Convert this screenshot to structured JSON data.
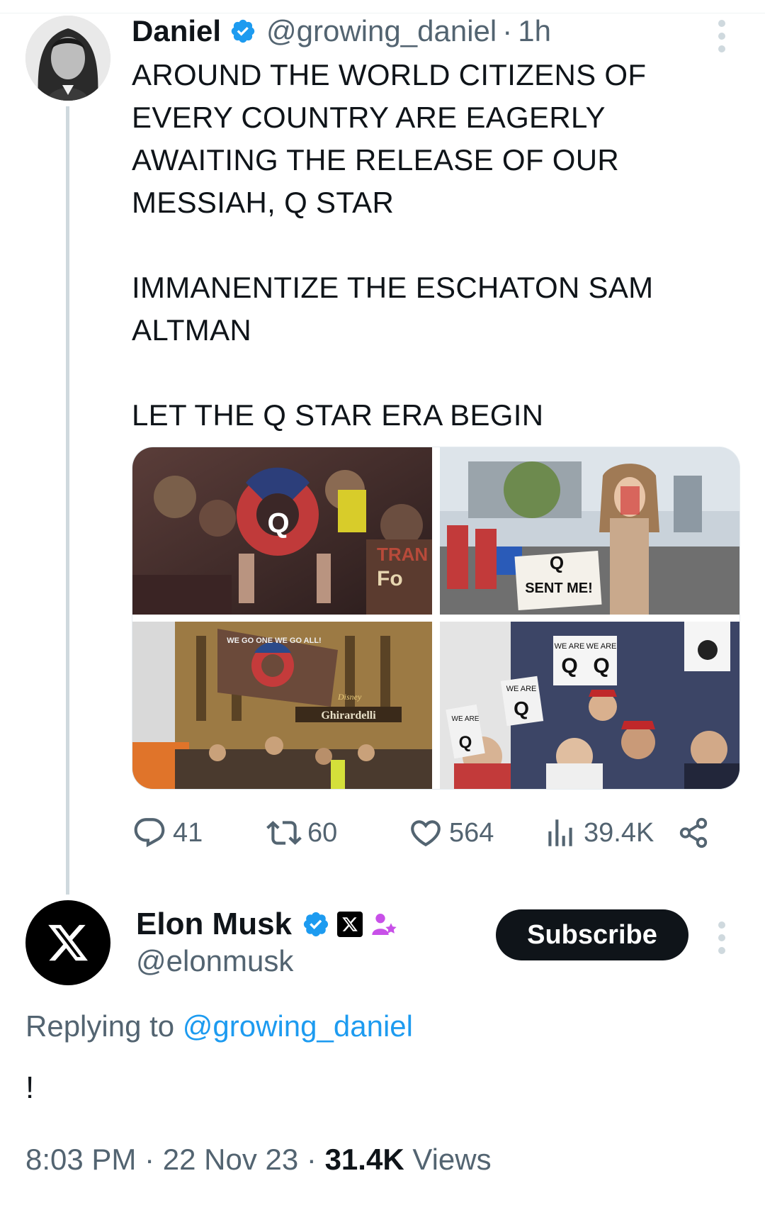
{
  "tweet1": {
    "name": "Daniel",
    "handle": "@growing_daniel",
    "separator": "·",
    "time": "1h",
    "text_p1": "AROUND THE WORLD CITIZENS OF EVERY COUNTRY ARE EAGERLY AWAITING THE RELEASE OF OUR MESSIAH, Q STAR",
    "text_p2": "IMMANENTIZE THE ESCHATON SAM ALTMAN",
    "text_p3": "LET THE Q STAR ERA BEGIN",
    "media_text": {
      "img1": [
        "Q",
        "TRAN",
        "Fo"
      ],
      "img2": [
        "Q",
        "SENT ME!"
      ],
      "img3": [
        "WE GO ONE WE GO ALL!",
        "Disney",
        "Ghirardelli"
      ],
      "img4": [
        "WE ARE",
        "Q",
        "WE ARE",
        "Q",
        "WE ARE",
        "Q",
        "WE ARE",
        "Q"
      ]
    },
    "actions": {
      "replies": "41",
      "reposts": "60",
      "likes": "564",
      "views": "39.4K"
    }
  },
  "tweet2": {
    "name": "Elon Musk",
    "handle": "@elonmusk",
    "subscribe_label": "Subscribe",
    "replying_prefix": "Replying to",
    "replying_handle": "@growing_daniel",
    "text": "!",
    "time": "8:03 PM",
    "sep1": "·",
    "date": "22 Nov 23",
    "sep2": "·",
    "views_count": "31.4K",
    "views_label": "Views"
  },
  "icons": [
    "verified-badge-icon",
    "more-options-icon",
    "reply-icon",
    "repost-icon",
    "like-icon",
    "views-icon",
    "share-icon",
    "x-logo-icon",
    "affiliate-badge-icon"
  ],
  "colors": {
    "verified": "#1d9bf0",
    "link": "#1d9bf0",
    "muted": "#536471",
    "text": "#0f1419",
    "affiliate": "#c850e8"
  }
}
